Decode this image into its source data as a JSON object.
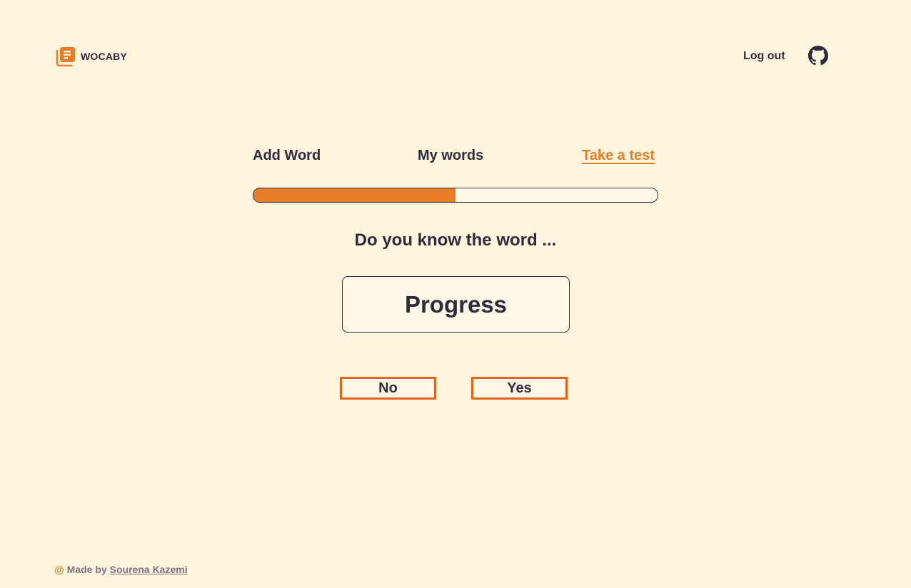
{
  "brand": {
    "name": "WOCABY",
    "icon": "notebook-icon",
    "accent_color": "#e87d27"
  },
  "header": {
    "logout_label": "Log out",
    "github_icon": "github-icon"
  },
  "nav": {
    "add_word": "Add Word",
    "my_words": "My words",
    "take_test": "Take a test",
    "active": "Take a test"
  },
  "test": {
    "progress": 0.5,
    "question": "Do you know the word ...",
    "word": "Progress",
    "no_label": "No",
    "yes_label": "Yes"
  },
  "footer": {
    "at_symbol": "@",
    "made_by": "Made by",
    "author": "Sourena Kazemi"
  },
  "colors": {
    "background": "#fff5dc",
    "text": "#2d2b3d",
    "accent": "#e87d27",
    "button_border": "#e0661b"
  }
}
